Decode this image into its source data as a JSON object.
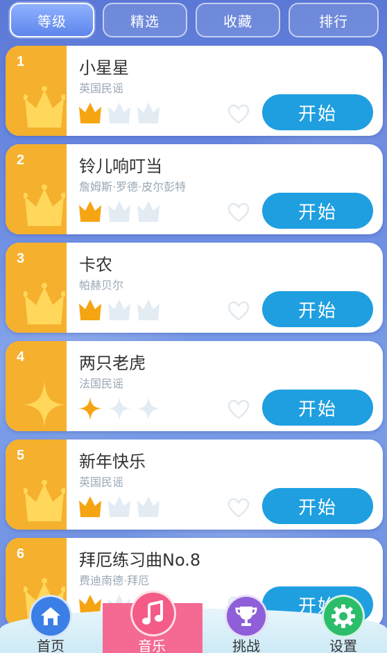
{
  "tabs": [
    {
      "label": "等级",
      "active": true
    },
    {
      "label": "精选",
      "active": false
    },
    {
      "label": "收藏",
      "active": false
    },
    {
      "label": "排行",
      "active": false
    }
  ],
  "songs": [
    {
      "num": "1",
      "title": "小星星",
      "artist": "英国民谣",
      "rating_icon": "crown-icon",
      "rating": 1,
      "rating_max": 3,
      "start_label": "开始"
    },
    {
      "num": "2",
      "title": "铃儿响叮当",
      "artist": "詹姆斯·罗德·皮尔彭特",
      "rating_icon": "crown-icon",
      "rating": 1,
      "rating_max": 3,
      "start_label": "开始"
    },
    {
      "num": "3",
      "title": "卡农",
      "artist": "帕赫贝尔",
      "rating_icon": "crown-icon",
      "rating": 1,
      "rating_max": 3,
      "start_label": "开始"
    },
    {
      "num": "4",
      "title": "两只老虎",
      "artist": "法国民谣",
      "rating_icon": "star-icon",
      "rating": 1,
      "rating_max": 3,
      "start_label": "开始"
    },
    {
      "num": "5",
      "title": "新年快乐",
      "artist": "英国民谣",
      "rating_icon": "crown-icon",
      "rating": 1,
      "rating_max": 3,
      "start_label": "开始"
    },
    {
      "num": "6",
      "title": "拜厄练习曲No.8",
      "artist": "费迪南德·拜厄",
      "rating_icon": "crown-icon",
      "rating": 1,
      "rating_max": 3,
      "start_label": "开始"
    }
  ],
  "nav": [
    {
      "label": "首页",
      "icon": "home-icon",
      "color": "#3b7fe6",
      "active": false
    },
    {
      "label": "音乐",
      "icon": "music-note-icon",
      "color": "#f45b86",
      "active": true
    },
    {
      "label": "挑战",
      "icon": "trophy-icon",
      "color": "#8e5fd8",
      "active": false
    },
    {
      "label": "设置",
      "icon": "gear-icon",
      "color": "#2bbd6a",
      "active": false
    }
  ],
  "colors": {
    "accent_orange": "#f5b02e",
    "start_blue": "#1f9fe0",
    "active_nav_pink": "#f46a93"
  }
}
